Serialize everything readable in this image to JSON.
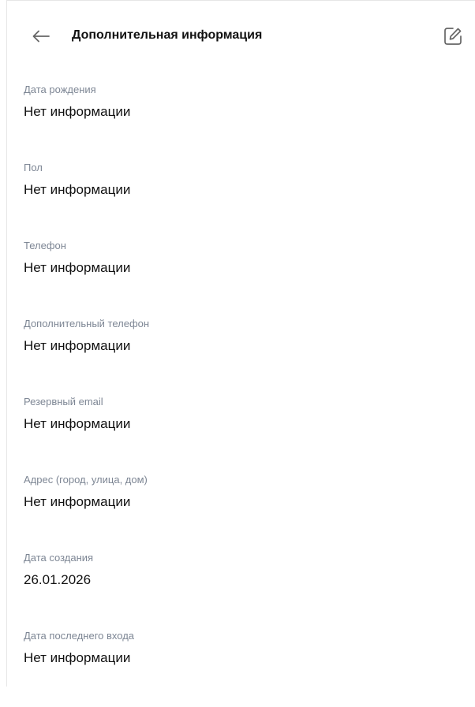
{
  "header": {
    "title": "Дополнительная информация",
    "back_icon": "arrow-left-icon",
    "edit_icon": "edit-icon"
  },
  "fields": [
    {
      "label": "Дата рождения",
      "value": "Нет информации"
    },
    {
      "label": "Пол",
      "value": "Нет информации"
    },
    {
      "label": "Телефон",
      "value": "Нет информации"
    },
    {
      "label": "Дополнительный телефон",
      "value": "Нет информации"
    },
    {
      "label": "Резервный email",
      "value": "Нет информации"
    },
    {
      "label": "Адрес (город, улица, дом)",
      "value": "Нет информации"
    },
    {
      "label": "Дата создания",
      "value": "26.01.2026"
    },
    {
      "label": "Дата последнего входа",
      "value": "Нет информации"
    }
  ],
  "colors": {
    "label": "#7d8694",
    "value": "#111111",
    "icon": "#666666",
    "border": "#e6e6e6"
  }
}
